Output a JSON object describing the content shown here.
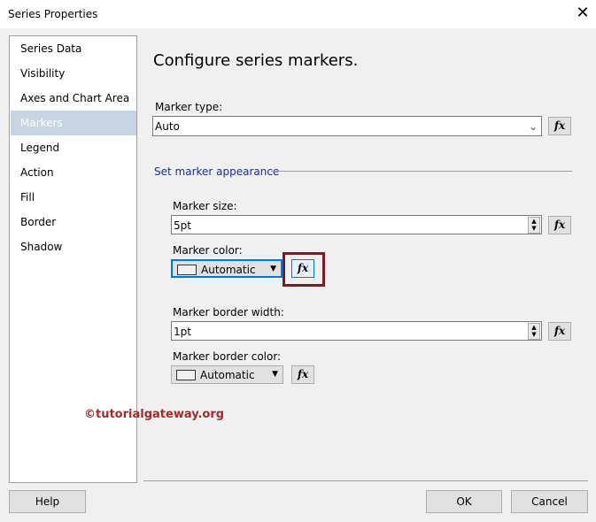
{
  "window": {
    "title": "Series Properties"
  },
  "sidebar": {
    "items": [
      {
        "label": "Series Data"
      },
      {
        "label": "Visibility"
      },
      {
        "label": "Axes and Chart Area"
      },
      {
        "label": "Markers"
      },
      {
        "label": "Legend"
      },
      {
        "label": "Action"
      },
      {
        "label": "Fill"
      },
      {
        "label": "Border"
      },
      {
        "label": "Shadow"
      }
    ],
    "selected": "Markers"
  },
  "main": {
    "heading": "Configure series markers.",
    "marker_type": {
      "label": "Marker type:",
      "value": "Auto"
    },
    "section": "Set marker appearance",
    "marker_size": {
      "label": "Marker size:",
      "value": "5pt"
    },
    "marker_color": {
      "label": "Marker color:",
      "value": "Automatic"
    },
    "marker_border_width": {
      "label": "Marker border width:",
      "value": "1pt"
    },
    "marker_border_color": {
      "label": "Marker border color:",
      "value": "Automatic"
    },
    "fx_label": "fx"
  },
  "watermark": "©tutorialgateway.org",
  "buttons": {
    "help": "Help",
    "ok": "OK",
    "cancel": "Cancel"
  },
  "colors": {
    "highlight_box": "#7b1a22",
    "focus": "#0078d7"
  }
}
